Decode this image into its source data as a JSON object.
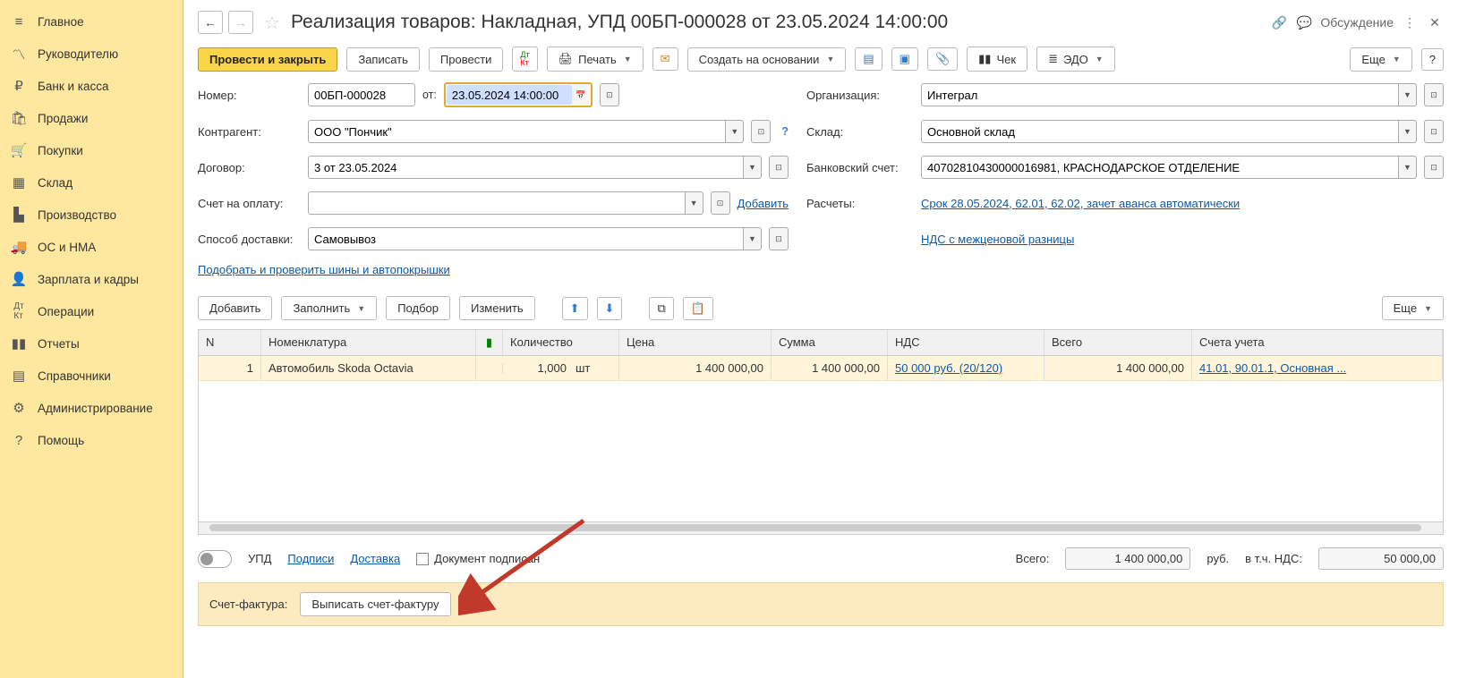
{
  "sidebar": {
    "items": [
      {
        "label": "Главное",
        "icon": "≡"
      },
      {
        "label": "Руководителю",
        "icon": "📈"
      },
      {
        "label": "Банк и касса",
        "icon": "₽"
      },
      {
        "label": "Продажи",
        "icon": "🛍"
      },
      {
        "label": "Покупки",
        "icon": "🛒"
      },
      {
        "label": "Склад",
        "icon": "▦"
      },
      {
        "label": "Производство",
        "icon": "🏭"
      },
      {
        "label": "ОС и НМА",
        "icon": "🚚"
      },
      {
        "label": "Зарплата и кадры",
        "icon": "👤"
      },
      {
        "label": "Операции",
        "icon": "ᴬᴮ"
      },
      {
        "label": "Отчеты",
        "icon": "📊"
      },
      {
        "label": "Справочники",
        "icon": "📚"
      },
      {
        "label": "Администрирование",
        "icon": "⚙"
      },
      {
        "label": "Помощь",
        "icon": "?"
      }
    ]
  },
  "header": {
    "title": "Реализация товаров: Накладная, УПД 00БП-000028 от 23.05.2024 14:00:00",
    "discuss": "Обсуждение"
  },
  "toolbar": {
    "post_close": "Провести и закрыть",
    "save": "Записать",
    "post": "Провести",
    "print": "Печать",
    "create_based": "Создать на основании",
    "cheque": "Чек",
    "edo": "ЭДО",
    "more": "Еще",
    "help": "?"
  },
  "form": {
    "number_label": "Номер:",
    "number": "00БП-000028",
    "from_label": "от:",
    "date": "23.05.2024 14:00:00",
    "org_label": "Организация:",
    "org": "Интеграл",
    "counterparty_label": "Контрагент:",
    "counterparty": "ООО \"Пончик\"",
    "warehouse_label": "Склад:",
    "warehouse": "Основной склад",
    "contract_label": "Договор:",
    "contract": "3 от 23.05.2024",
    "bank_label": "Банковский счет:",
    "bank": "40702810430000016981, КРАСНОДАРСКОЕ ОТДЕЛЕНИЕ",
    "invoice_label": "Счет на оплату:",
    "invoice": "",
    "add_link": "Добавить",
    "settlements_label": "Расчеты:",
    "settlements_link": "Срок 28.05.2024, 62.01, 62.02, зачет аванса автоматически",
    "delivery_label": "Способ доставки:",
    "delivery": "Самовывоз",
    "nds_link": "НДС с межценовой разницы",
    "check_tires_link": "Подобрать и проверить шины и автопокрышки"
  },
  "table_toolbar": {
    "add": "Добавить",
    "fill": "Заполнить",
    "pick": "Подбор",
    "change": "Изменить",
    "more": "Еще"
  },
  "table": {
    "headers": {
      "n": "N",
      "nom": "Номенклатура",
      "qty": "Количество",
      "price": "Цена",
      "sum": "Сумма",
      "nds": "НДС",
      "total": "Всего",
      "acc": "Счета учета"
    },
    "rows": [
      {
        "n": "1",
        "nom": "Автомобиль Skoda Octavia",
        "qty": "1,000",
        "unit": "шт",
        "price": "1 400 000,00",
        "sum": "1 400 000,00",
        "nds": "50 000 руб. (20/120)",
        "total": "1 400 000,00",
        "acc": "41.01, 90.01.1, Основная ..."
      }
    ]
  },
  "footer": {
    "upd": "УПД",
    "signatures": "Подписи",
    "delivery": "Доставка",
    "doc_signed": "Документ подписан",
    "total_label": "Всего:",
    "total_value": "1 400 000,00",
    "currency": "руб.",
    "incl_nds_label": "в т.ч. НДС:",
    "incl_nds_value": "50 000,00"
  },
  "invoice": {
    "label": "Счет-фактура:",
    "button": "Выписать счет-фактуру"
  }
}
